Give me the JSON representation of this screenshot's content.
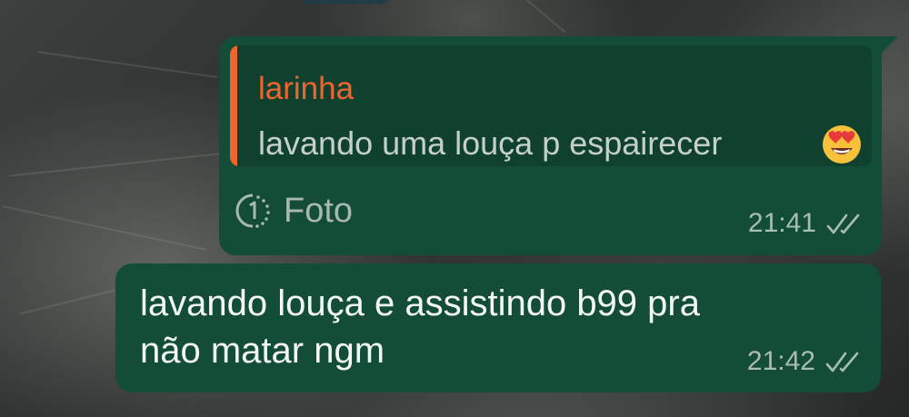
{
  "chat": {
    "messages": [
      {
        "direction": "outgoing",
        "quoted": {
          "author": "larinha",
          "text": "lavando uma louça p espairecer",
          "emoji": "smiling-face-with-heart-eyes"
        },
        "media_label": "Foto",
        "media_icon": "view-once-icon",
        "time": "21:41",
        "status": "read"
      },
      {
        "direction": "outgoing",
        "lines": [
          "lavando louça e assistindo b99 pra",
          "não matar ngm"
        ],
        "time": "21:42",
        "status": "read"
      }
    ]
  },
  "colors": {
    "bubble": "#134d37",
    "quote_background": "#10412e",
    "quote_accent": "#f0652e",
    "meta_text": "#a9bdb5"
  }
}
